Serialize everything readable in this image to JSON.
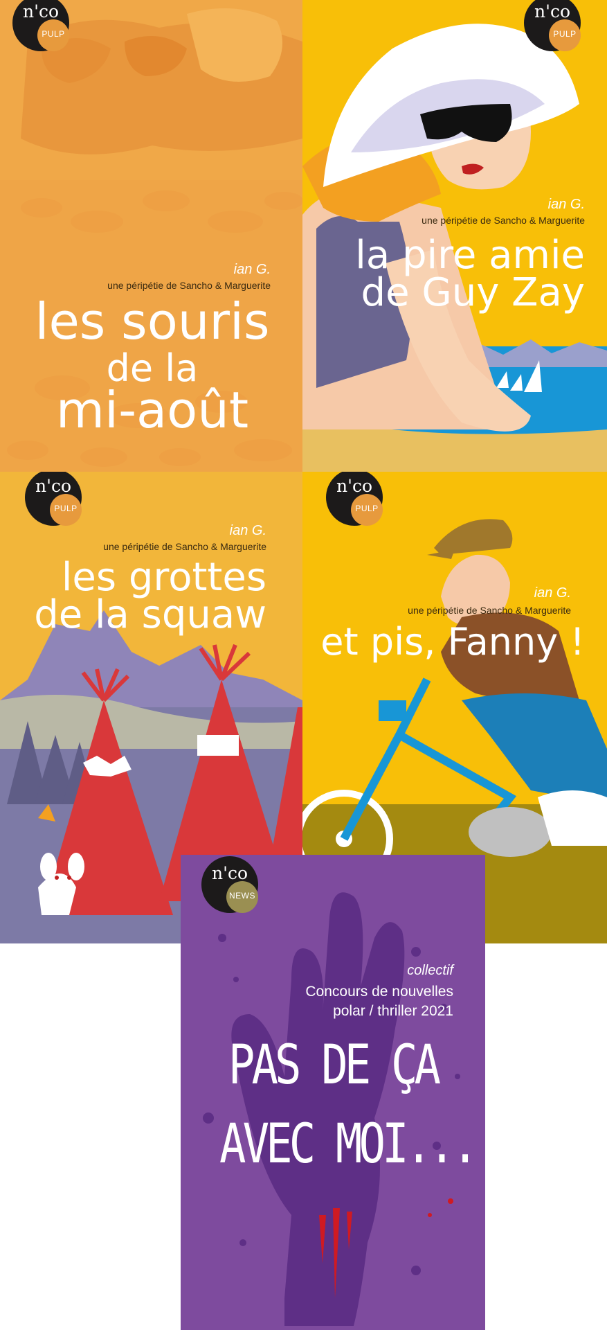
{
  "covers": [
    {
      "author": "ian G.",
      "subtitle": "une péripétie de Sancho & Marguerite",
      "title_lines": [
        "les souris",
        "de la",
        "mi-août"
      ],
      "logo": {
        "brand": "n'co",
        "series": "PULP"
      }
    },
    {
      "author": "ian G.",
      "subtitle": "une péripétie de Sancho & Marguerite",
      "title_lines": [
        "la pire amie",
        "de Guy Zay"
      ],
      "logo": {
        "brand": "n'co",
        "series": "PULP"
      }
    },
    {
      "author": "ian G.",
      "subtitle": "une péripétie de Sancho & Marguerite",
      "title_lines": [
        "les grottes",
        "de la squaw"
      ],
      "logo": {
        "brand": "n'co",
        "series": "PULP"
      }
    },
    {
      "author": "ian G.",
      "subtitle": "une péripétie de Sancho & Marguerite",
      "title_lines": [
        "et pis, Fanny !"
      ],
      "logo": {
        "brand": "n'co",
        "series": "PULP"
      }
    },
    {
      "author": "collectif",
      "subtitle_lines": [
        "Concours de nouvelles",
        "polar / thriller 2021"
      ],
      "title_lines": [
        "PAS DE ÇA",
        "AVEC MOI..."
      ],
      "logo": {
        "brand": "n'co",
        "series": "NEWS"
      }
    }
  ],
  "colors": {
    "orange": "#f0a040",
    "yellow": "#f8bf08",
    "mustard": "#f2b63a",
    "purple": "#7e4b9e",
    "pulp_badge": "#e79a3d",
    "news_badge": "#9a8f52"
  }
}
